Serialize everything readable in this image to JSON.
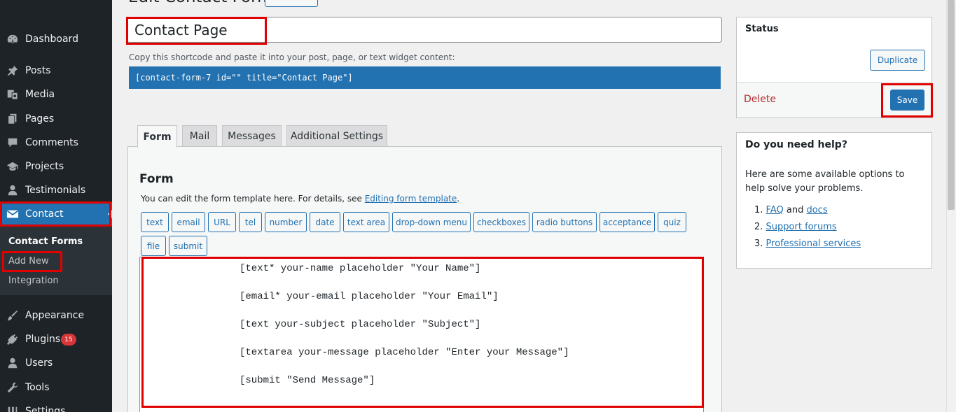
{
  "sidebar": {
    "items": [
      {
        "label": "Dashboard",
        "icon": "dashboard-icon"
      },
      {
        "label": "Posts",
        "icon": "pin-icon"
      },
      {
        "label": "Media",
        "icon": "media-icon"
      },
      {
        "label": "Pages",
        "icon": "pages-icon"
      },
      {
        "label": "Comments",
        "icon": "comment-icon"
      },
      {
        "label": "Projects",
        "icon": "graduation-cap-icon"
      },
      {
        "label": "Testimonials",
        "icon": "user-icon"
      },
      {
        "label": "Contact",
        "icon": "envelope-icon"
      },
      {
        "label": "Appearance",
        "icon": "brush-icon"
      },
      {
        "label": "Plugins",
        "icon": "plug-icon",
        "badge": "15"
      },
      {
        "label": "Users",
        "icon": "users-icon"
      },
      {
        "label": "Tools",
        "icon": "wrench-icon"
      },
      {
        "label": "Settings",
        "icon": "settings-icon"
      }
    ],
    "submenu": [
      "Contact Forms",
      "Add New",
      "Integration"
    ]
  },
  "header": {
    "title": "Edit Contact Form"
  },
  "form": {
    "title_value": "Contact Page",
    "shortcode_hint": "Copy this shortcode and paste it into your post, page, or text widget content:",
    "shortcode": "[contact-form-7 id=\"\" title=\"Contact Page\"]"
  },
  "tabs": [
    "Form",
    "Mail",
    "Messages",
    "Additional Settings"
  ],
  "panel": {
    "title": "Form",
    "desc_prefix": "You can edit the form template here. For details, see ",
    "desc_link": "Editing form template",
    "desc_suffix": ".",
    "tag_buttons": [
      "text",
      "email",
      "URL",
      "tel",
      "number",
      "date",
      "text area",
      "drop-down menu",
      "checkboxes",
      "radio buttons",
      "acceptance",
      "quiz",
      "file",
      "submit"
    ],
    "code_lines": [
      "[text* your-name placeholder \"Your Name\"]",
      "[email* your-email placeholder \"Your Email\"]",
      "[text your-subject placeholder \"Subject\"]",
      "[textarea your-message placeholder \"Enter your Message\"]",
      "[submit \"Send Message\"]"
    ]
  },
  "status": {
    "title": "Status",
    "duplicate_label": "Duplicate",
    "delete_label": "Delete",
    "save_label": "Save"
  },
  "help": {
    "title": "Do you need help?",
    "text": "Here are some available options to help solve your problems.",
    "items": [
      {
        "num": "1.",
        "link": "FAQ",
        "mid": " and ",
        "link2": "docs"
      },
      {
        "num": "2.",
        "link": "Support forums"
      },
      {
        "num": "3.",
        "link": "Professional services"
      }
    ]
  },
  "colors": {
    "accent": "#2271b1",
    "sidebar_bg": "#1d2327",
    "highlight": "#e00000",
    "delete": "#b32d2e",
    "badge": "#d63638"
  }
}
